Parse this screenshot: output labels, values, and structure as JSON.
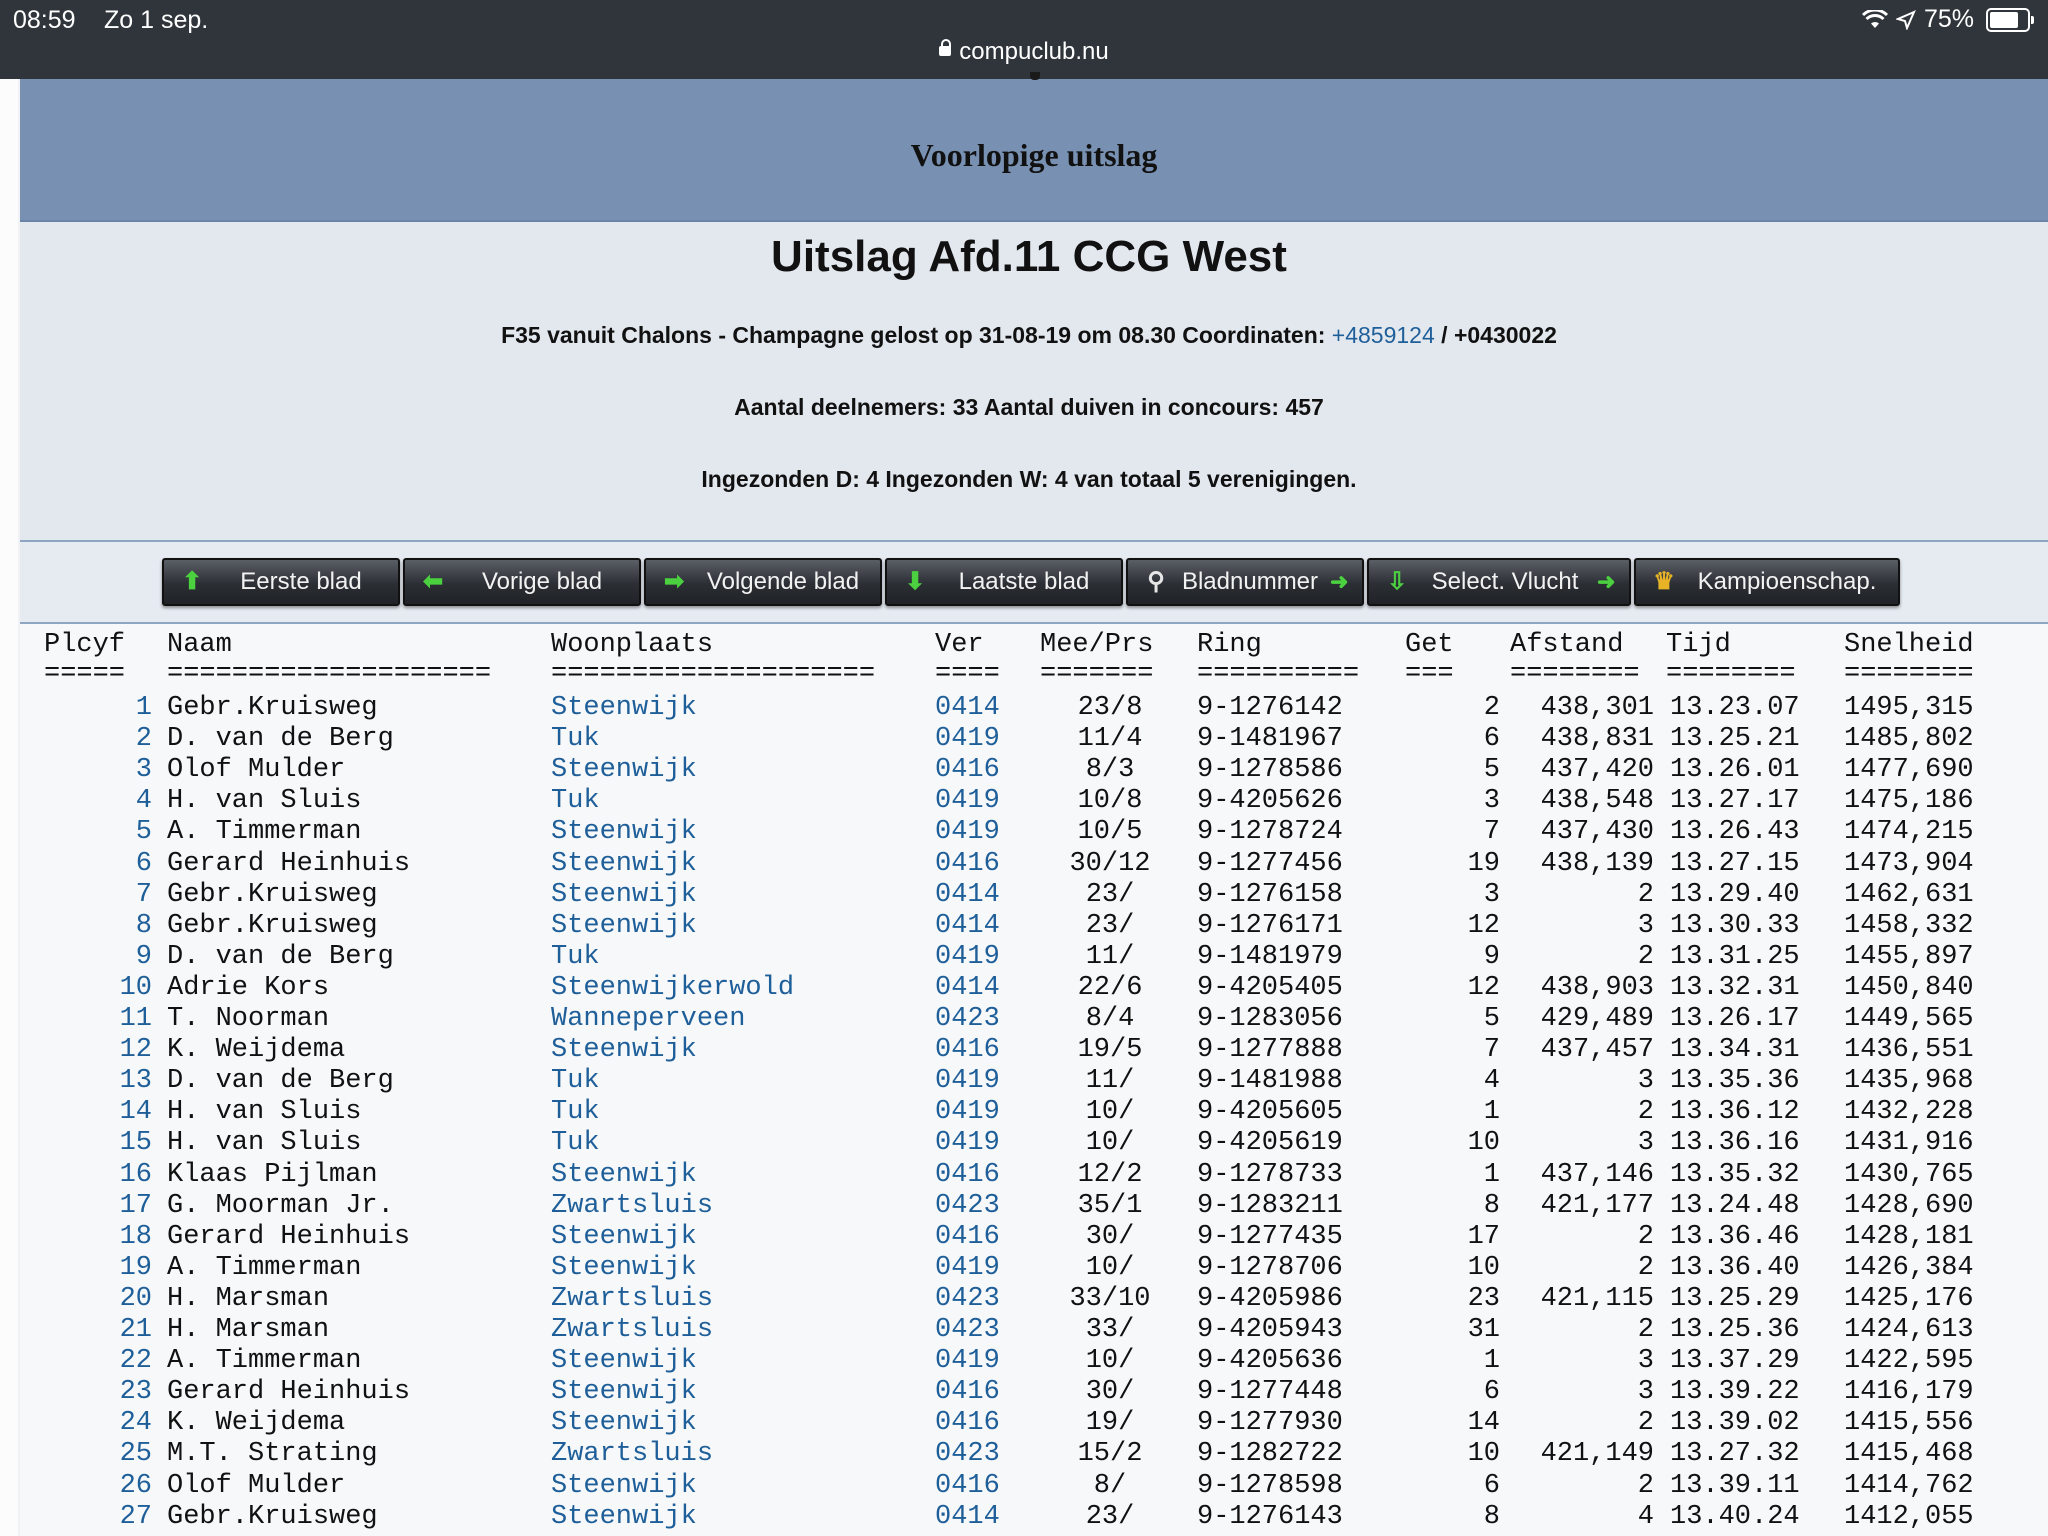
{
  "status": {
    "time": "08:59",
    "date": "Zo 1 sep.",
    "battery": "75%",
    "url": "compuclub.nu"
  },
  "header": {
    "title": "Voorlopige uitslag"
  },
  "info": {
    "title": "Uitslag Afd.11 CCG West",
    "flight_prefix": "F35 vanuit Chalons - Champagne gelost op 31-08-19 om 08.30 Coordinaten:",
    "coord1": "+4859124",
    "coord_sep": " / ",
    "coord2": "+0430022",
    "participants": "Aantal deelnemers: 33 Aantal duiven in concours: 457",
    "sent": "Ingezonden D: 4 Ingezonden W: 4 van totaal 5 verenigingen."
  },
  "toolbar": {
    "first": "Eerste blad",
    "prev": "Vorige blad",
    "next": "Volgende blad",
    "last": "Laatste blad",
    "page": "Bladnummer",
    "select": "Select. Vlucht",
    "champ": "Kampioenschap."
  },
  "table": {
    "columns": [
      "Plcyf",
      "Naam",
      "Woonplaats",
      "Ver",
      "Mee/Prs",
      "Ring",
      "Get",
      "Afstand",
      "Tijd",
      "Snelheid"
    ],
    "separators": [
      "=====",
      "====================",
      "====================",
      "====",
      "=======",
      "==========",
      "===",
      "========",
      "========",
      "========"
    ],
    "rows": [
      [
        "1",
        "Gebr.Kruisweg",
        "Steenwijk",
        "0414",
        "23/8",
        "9-1276142",
        "2",
        "438,301",
        "13.23.07",
        "1495,315"
      ],
      [
        "2",
        "D. van de Berg",
        "Tuk",
        "0419",
        "11/4",
        "9-1481967",
        "6",
        "438,831",
        "13.25.21",
        "1485,802"
      ],
      [
        "3",
        "Olof Mulder",
        "Steenwijk",
        "0416",
        "8/3",
        "9-1278586",
        "5",
        "437,420",
        "13.26.01",
        "1477,690"
      ],
      [
        "4",
        "H. van Sluis",
        "Tuk",
        "0419",
        "10/8",
        "9-4205626",
        "3",
        "438,548",
        "13.27.17",
        "1475,186"
      ],
      [
        "5",
        "A. Timmerman",
        "Steenwijk",
        "0419",
        "10/5",
        "9-1278724",
        "7",
        "437,430",
        "13.26.43",
        "1474,215"
      ],
      [
        "6",
        "Gerard Heinhuis",
        "Steenwijk",
        "0416",
        "30/12",
        "9-1277456",
        "19",
        "438,139",
        "13.27.15",
        "1473,904"
      ],
      [
        "7",
        "Gebr.Kruisweg",
        "Steenwijk",
        "0414",
        "23/",
        "9-1276158",
        "3",
        "2",
        "13.29.40",
        "1462,631"
      ],
      [
        "8",
        "Gebr.Kruisweg",
        "Steenwijk",
        "0414",
        "23/",
        "9-1276171",
        "12",
        "3",
        "13.30.33",
        "1458,332"
      ],
      [
        "9",
        "D. van de Berg",
        "Tuk",
        "0419",
        "11/",
        "9-1481979",
        "9",
        "2",
        "13.31.25",
        "1455,897"
      ],
      [
        "10",
        "Adrie Kors",
        "Steenwijkerwold",
        "0414",
        "22/6",
        "9-4205405",
        "12",
        "438,903",
        "13.32.31",
        "1450,840"
      ],
      [
        "11",
        "T. Noorman",
        "Wanneperveen",
        "0423",
        "8/4",
        "9-1283056",
        "5",
        "429,489",
        "13.26.17",
        "1449,565"
      ],
      [
        "12",
        "K. Weijdema",
        "Steenwijk",
        "0416",
        "19/5",
        "9-1277888",
        "7",
        "437,457",
        "13.34.31",
        "1436,551"
      ],
      [
        "13",
        "D. van de Berg",
        "Tuk",
        "0419",
        "11/",
        "9-1481988",
        "4",
        "3",
        "13.35.36",
        "1435,968"
      ],
      [
        "14",
        "H. van Sluis",
        "Tuk",
        "0419",
        "10/",
        "9-4205605",
        "1",
        "2",
        "13.36.12",
        "1432,228"
      ],
      [
        "15",
        "H. van Sluis",
        "Tuk",
        "0419",
        "10/",
        "9-4205619",
        "10",
        "3",
        "13.36.16",
        "1431,916"
      ],
      [
        "16",
        "Klaas Pijlman",
        "Steenwijk",
        "0416",
        "12/2",
        "9-1278733",
        "1",
        "437,146",
        "13.35.32",
        "1430,765"
      ],
      [
        "17",
        "G. Moorman Jr.",
        "Zwartsluis",
        "0423",
        "35/1",
        "9-1283211",
        "8",
        "421,177",
        "13.24.48",
        "1428,690"
      ],
      [
        "18",
        "Gerard Heinhuis",
        "Steenwijk",
        "0416",
        "30/",
        "9-1277435",
        "17",
        "2",
        "13.36.46",
        "1428,181"
      ],
      [
        "19",
        "A. Timmerman",
        "Steenwijk",
        "0419",
        "10/",
        "9-1278706",
        "10",
        "2",
        "13.36.40",
        "1426,384"
      ],
      [
        "20",
        "H. Marsman",
        "Zwartsluis",
        "0423",
        "33/10",
        "9-4205986",
        "23",
        "421,115",
        "13.25.29",
        "1425,176"
      ],
      [
        "21",
        "H. Marsman",
        "Zwartsluis",
        "0423",
        "33/",
        "9-4205943",
        "31",
        "2",
        "13.25.36",
        "1424,613"
      ],
      [
        "22",
        "A. Timmerman",
        "Steenwijk",
        "0419",
        "10/",
        "9-4205636",
        "1",
        "3",
        "13.37.29",
        "1422,595"
      ],
      [
        "23",
        "Gerard Heinhuis",
        "Steenwijk",
        "0416",
        "30/",
        "9-1277448",
        "6",
        "3",
        "13.39.22",
        "1416,179"
      ],
      [
        "24",
        "K. Weijdema",
        "Steenwijk",
        "0416",
        "19/",
        "9-1277930",
        "14",
        "2",
        "13.39.02",
        "1415,556"
      ],
      [
        "25",
        "M.T. Strating",
        "Zwartsluis",
        "0423",
        "15/2",
        "9-1282722",
        "10",
        "421,149",
        "13.27.32",
        "1415,468"
      ],
      [
        "26",
        "Olof Mulder",
        "Steenwijk",
        "0416",
        "8/",
        "9-1278598",
        "6",
        "2",
        "13.39.11",
        "1414,762"
      ],
      [
        "27",
        "Gebr.Kruisweg",
        "Steenwijk",
        "0414",
        "23/",
        "9-1276143",
        "8",
        "4",
        "13.40.24",
        "1412,055"
      ]
    ]
  }
}
